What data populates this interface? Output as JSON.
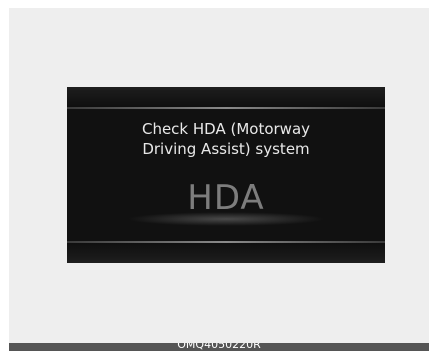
{
  "display": {
    "message_line1": "Check HDA (Motorway",
    "message_line2": "Driving Assist) system",
    "indicator": "HDA"
  },
  "caption": {
    "code": "OMQ4050220R"
  },
  "colors": {
    "background": "#eeeeee",
    "screen": "#111111",
    "text": "#e8e8e8",
    "indicator": "#7d7d7d",
    "caption_bar": "#555555"
  }
}
